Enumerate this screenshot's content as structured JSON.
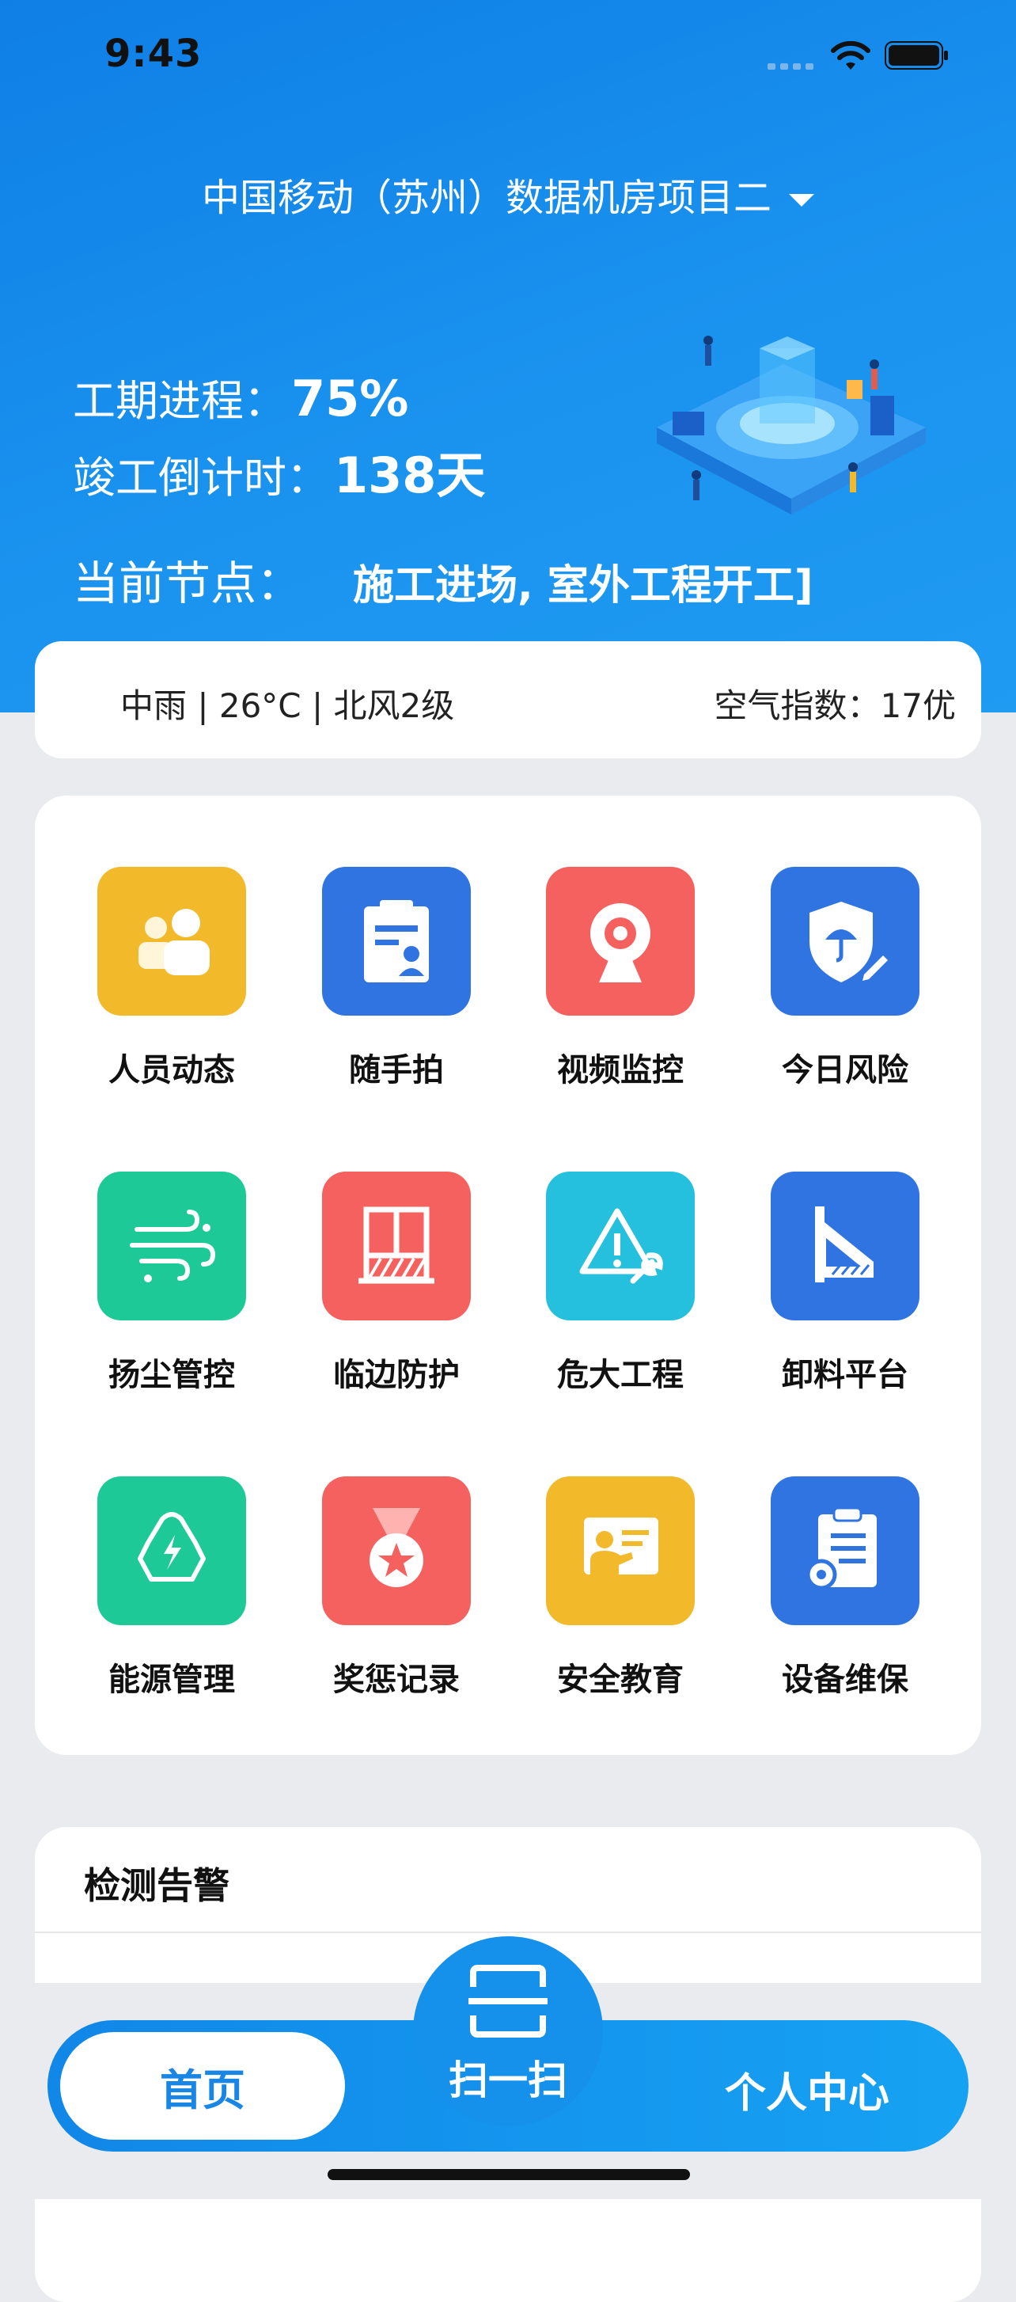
{
  "status_bar": {
    "time": "9:43"
  },
  "header": {
    "project_title": "中国移动（苏州）数据机房项目二",
    "progress_label": "工期进程：",
    "progress_value": "75%",
    "countdown_label": "竣工倒计时：",
    "countdown_value": "138天",
    "node_label": "当前节点：",
    "node_value": "施工进场, 室外工程开工]"
  },
  "weather": {
    "summary": "中雨 | 26°C | 北风2级",
    "air_quality": "空气指数：17优"
  },
  "grid": {
    "items": [
      {
        "label": "人员动态",
        "icon": "people-icon",
        "color": "#f2b92b"
      },
      {
        "label": "随手拍",
        "icon": "snapshot-clipboard-icon",
        "color": "#2f74e0"
      },
      {
        "label": "视频监控",
        "icon": "webcam-icon",
        "color": "#f4615f"
      },
      {
        "label": "今日风险",
        "icon": "shield-umbrella-icon",
        "color": "#2f74e0"
      },
      {
        "label": "扬尘管控",
        "icon": "wind-icon",
        "color": "#1ec998"
      },
      {
        "label": "临边防护",
        "icon": "window-guard-icon",
        "color": "#f4615f"
      },
      {
        "label": "危大工程",
        "icon": "warning-wrench-icon",
        "color": "#25c0de"
      },
      {
        "label": "卸料平台",
        "icon": "platform-ruler-icon",
        "color": "#2f74e0"
      },
      {
        "label": "能源管理",
        "icon": "recycle-energy-icon",
        "color": "#1ec998"
      },
      {
        "label": "奖惩记录",
        "icon": "medal-icon",
        "color": "#f4615f"
      },
      {
        "label": "安全教育",
        "icon": "teacher-board-icon",
        "color": "#f2b92b"
      },
      {
        "label": "设备维保",
        "icon": "clipboard-gear-icon",
        "color": "#2f74e0"
      }
    ]
  },
  "alerts": {
    "title": "检测告警"
  },
  "tabbar": {
    "home": "首页",
    "scan": "扫一扫",
    "profile": "个人中心"
  },
  "theme": {
    "primary": "#1a8eea",
    "background": "#e9ebef"
  }
}
